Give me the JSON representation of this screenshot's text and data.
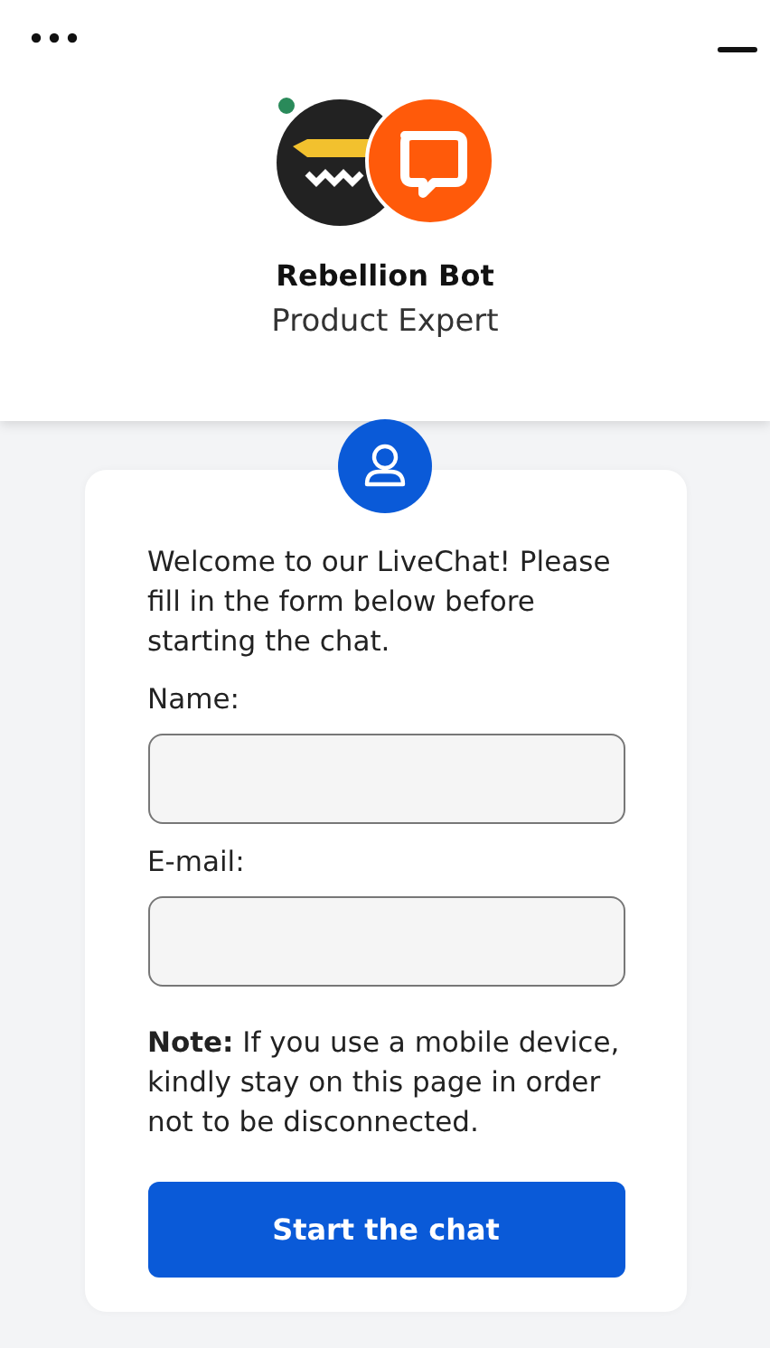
{
  "header": {
    "agent_name": "Rebellion Bot",
    "agent_role": "Product Expert",
    "online": true
  },
  "form": {
    "intro": "Welcome to our LiveChat! Please fill in the form below before starting the chat.",
    "fields": [
      {
        "label": "Name:"
      },
      {
        "label": "E-mail:"
      }
    ],
    "note": "**Note:** If you use a mobile device, kindly stay on this page in order not to be disconnected.",
    "button": "Start the chat"
  }
}
